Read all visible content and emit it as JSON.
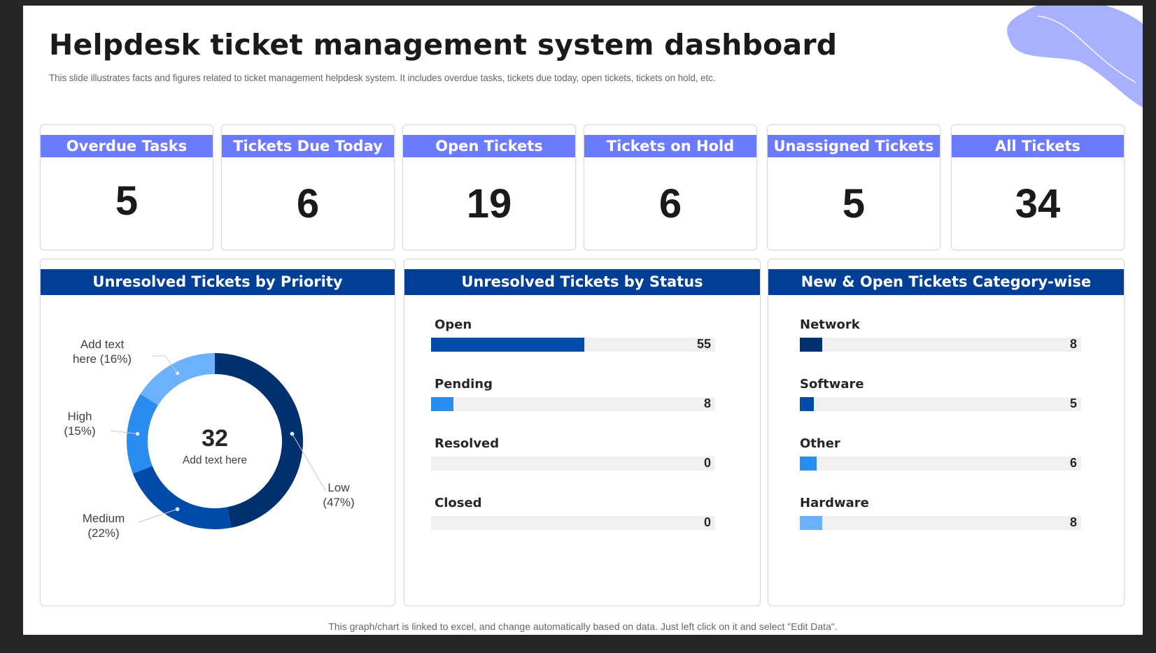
{
  "header": {
    "title": "Helpdesk ticket management system dashboard",
    "subtitle": "This slide illustrates facts and figures related to ticket management helpdesk system. It includes overdue tasks, tickets due today, open tickets, tickets on hold, etc."
  },
  "kpis": [
    {
      "label": "Overdue Tasks",
      "value": "5"
    },
    {
      "label": "Tickets Due Today",
      "value": "6"
    },
    {
      "label": "Open Tickets",
      "value": "19"
    },
    {
      "label": "Tickets on Hold",
      "value": "6"
    },
    {
      "label": "Unassigned Tickets",
      "value": "5"
    },
    {
      "label": "All Tickets",
      "value": "34"
    }
  ],
  "panels": {
    "priority": {
      "title": "Unresolved Tickets by Priority",
      "center_value": "32",
      "center_text": "Add text here"
    },
    "status": {
      "title": "Unresolved Tickets by Status"
    },
    "category": {
      "title": "New & Open Tickets Category-wise"
    }
  },
  "chart_data": [
    {
      "type": "pie",
      "title": "Unresolved Tickets by Priority",
      "slices": [
        {
          "label_lines": [
            "Low",
            "(47%)"
          ],
          "value": 47,
          "color": "#00306e"
        },
        {
          "label_lines": [
            "Medium",
            "(22%)"
          ],
          "value": 22,
          "color": "#004aa8"
        },
        {
          "label_lines": [
            "High",
            "(15%)"
          ],
          "value": 15,
          "color": "#2a8cf0"
        },
        {
          "label_lines": [
            "Add text",
            "here (16%)"
          ],
          "value": 16,
          "color": "#6cb1fb"
        }
      ]
    },
    {
      "type": "bar",
      "title": "Unresolved Tickets by Status",
      "categories": [
        "Open",
        "Pending",
        "Resolved",
        "Closed"
      ],
      "values": [
        55,
        8,
        0,
        0
      ],
      "fill_fractions": [
        0.54,
        0.08,
        0,
        0
      ],
      "colors": [
        "#004aa8",
        "#2a8cf0",
        "#2a8cf0",
        "#2a8cf0"
      ]
    },
    {
      "type": "bar",
      "title": "New & Open Tickets Category-wise",
      "categories": [
        "Network",
        "Software",
        "Other",
        "Hardware"
      ],
      "values": [
        8,
        5,
        6,
        8
      ],
      "fill_fractions": [
        0.08,
        0.05,
        0.06,
        0.08
      ],
      "colors": [
        "#00306e",
        "#004aa8",
        "#2a8cf0",
        "#6cb1fb"
      ]
    }
  ],
  "footer": {
    "note": "This graph/chart is linked to excel, and change automatically based on data. Just left click on it and select \"Edit Data\"."
  },
  "colors": {
    "kpi_header": "#6b7bff",
    "panel_header": "#003f95",
    "blob": "#a8b1ff",
    "track": "#f0f0f0"
  }
}
